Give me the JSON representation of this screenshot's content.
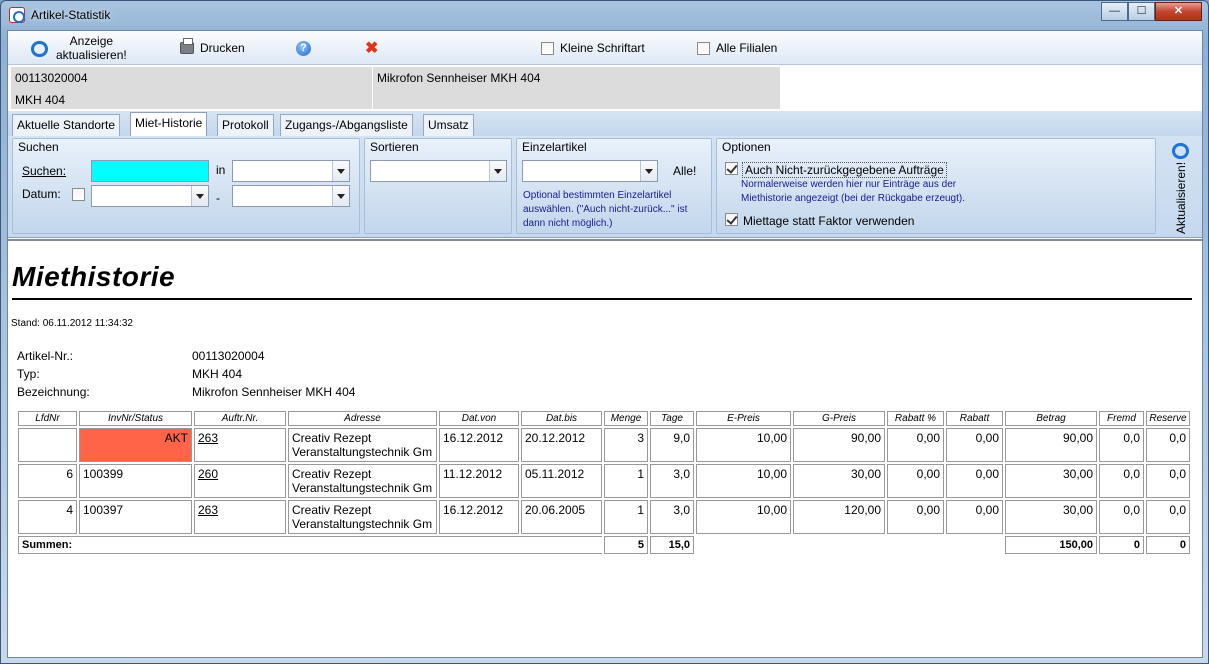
{
  "window": {
    "title": "Artikel-Statistik",
    "min": "—",
    "max": "☐",
    "close": "✕"
  },
  "toolbar": {
    "refresh_line1": "Anzeige",
    "refresh_line2": "aktualisieren!",
    "print": "Drucken",
    "small_font": "Kleine Schriftart",
    "all_branches": "Alle Filialen"
  },
  "article": {
    "nr": "00113020004",
    "typ": "MKH 404",
    "bez": "Mikrofon Sennheiser MKH 404"
  },
  "tabs": [
    "Aktuelle Standorte",
    "Miet-Historie",
    "Protokoll",
    "Zugangs-/Abgangsliste",
    "Umsatz"
  ],
  "filter": {
    "suchen_title": "Suchen",
    "suchen_label": "Suchen:",
    "in_label": "in",
    "datum_label": "Datum:",
    "dash": "-",
    "sortieren_title": "Sortieren",
    "einzel_title": "Einzelartikel",
    "alle": "Alle!",
    "einzel_hint": "Optional bestimmten Einzelartikel auswählen. (\"Auch nicht-zurück...\" ist dann nicht möglich.)",
    "optionen_title": "Optionen",
    "opt1": "Auch Nicht-zurückgegebene Aufträge",
    "opt1_hint": "Normalerweise werden hier nur Einträge aus der Miethistorie angezeigt (bei der Rückgabe erzeugt).",
    "opt2": "Miettage statt Faktor verwenden",
    "aktualisieren": "Aktualisieren!"
  },
  "report": {
    "title": "Miethistorie",
    "stand": "Stand: 06.11.2012 11:34:32",
    "labels": {
      "nr": "Artikel-Nr.:",
      "typ": "Typ:",
      "bez": "Bezeichnung:"
    },
    "columns": [
      "LfdNr",
      "InvNr/Status",
      "Auftr.Nr.",
      "Adresse",
      "Dat.von",
      "Dat.bis",
      "Menge",
      "Tage",
      "E-Preis",
      "G-Preis",
      "Rabatt %",
      "Rabatt",
      "Betrag",
      "Fremd",
      "Reserve"
    ],
    "rows": [
      {
        "lfd": "",
        "inv": "AKT",
        "auftr": "263",
        "adr1": "Creativ Rezept",
        "adr2": "Veranstaltungstechnik Gm",
        "von": "16.12.2012",
        "bis": "20.12.2012",
        "menge": "3",
        "tage": "9,0",
        "epreis": "10,00",
        "gpreis": "90,00",
        "rabp": "0,00",
        "rab": "0,00",
        "betrag": "90,00",
        "fremd": "0,0",
        "reserve": "0,0"
      },
      {
        "lfd": "6",
        "inv": "100399",
        "auftr": "260",
        "adr1": "Creativ Rezept",
        "adr2": "Veranstaltungstechnik Gm",
        "von": "11.12.2012",
        "bis": "05.11.2012",
        "menge": "1",
        "tage": "3,0",
        "epreis": "10,00",
        "gpreis": "30,00",
        "rabp": "0,00",
        "rab": "0,00",
        "betrag": "30,00",
        "fremd": "0,0",
        "reserve": "0,0"
      },
      {
        "lfd": "4",
        "inv": "100397",
        "auftr": "263",
        "adr1": "Creativ Rezept",
        "adr2": "Veranstaltungstechnik Gm",
        "von": "16.12.2012",
        "bis": "20.06.2005",
        "menge": "1",
        "tage": "3,0",
        "epreis": "10,00",
        "gpreis": "120,00",
        "rabp": "0,00",
        "rab": "0,00",
        "betrag": "30,00",
        "fremd": "0,0",
        "reserve": "0,0"
      }
    ],
    "sum": {
      "label": "Summen:",
      "menge": "5",
      "tage": "15,0",
      "betrag": "150,00",
      "fremd": "0",
      "reserve": "0"
    }
  },
  "colors": {
    "akt_status": "#ff6348",
    "search_field": "#00ffff",
    "hint_text": "#1a1a8c"
  }
}
